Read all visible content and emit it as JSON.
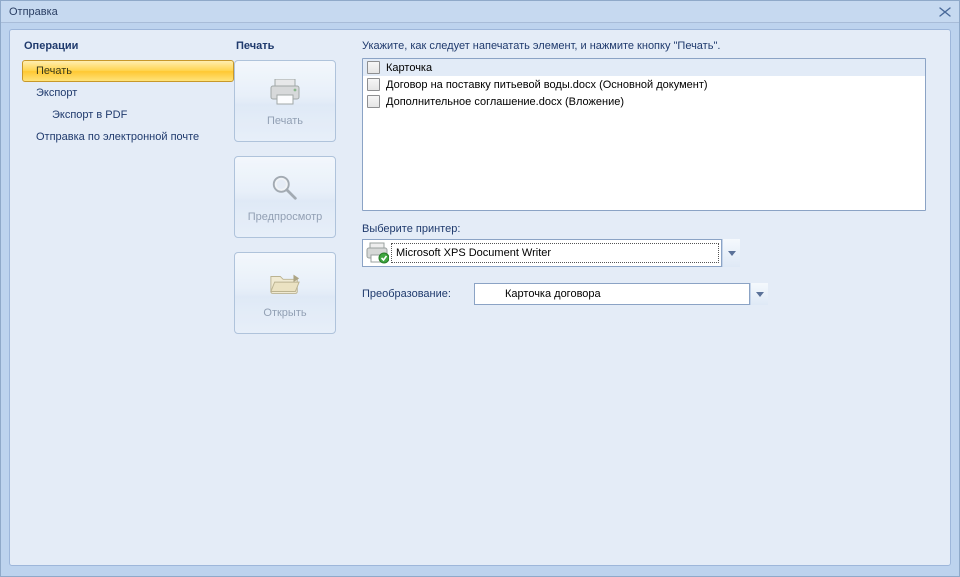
{
  "window": {
    "title": "Отправка"
  },
  "sidebar": {
    "header": "Операции",
    "items": [
      {
        "label": "Печать",
        "selected": true
      },
      {
        "label": "Экспорт"
      },
      {
        "label": "Экспорт в PDF",
        "indent": true
      },
      {
        "label": "Отправка по электронной почте"
      }
    ]
  },
  "center": {
    "header": "Печать",
    "buttons": [
      {
        "label": "Печать",
        "icon": "printer"
      },
      {
        "label": "Предпросмотр",
        "icon": "magnifier"
      },
      {
        "label": "Открыть",
        "icon": "folder"
      }
    ]
  },
  "right": {
    "instruction": "Укажите, как следует напечатать элемент, и нажмите кнопку \"Печать\".",
    "items": [
      {
        "label": "Карточка",
        "checked": false,
        "selected": true
      },
      {
        "label": "Договор на поставку питьевой воды.docx (Основной документ)",
        "checked": false
      },
      {
        "label": "Дополнительное соглашение.docx (Вложение)",
        "checked": false
      }
    ],
    "printer_label": "Выберите принтер:",
    "printer_value": "Microsoft XPS Document Writer",
    "transform_label": "Преобразование:",
    "transform_value": "Карточка договора"
  }
}
